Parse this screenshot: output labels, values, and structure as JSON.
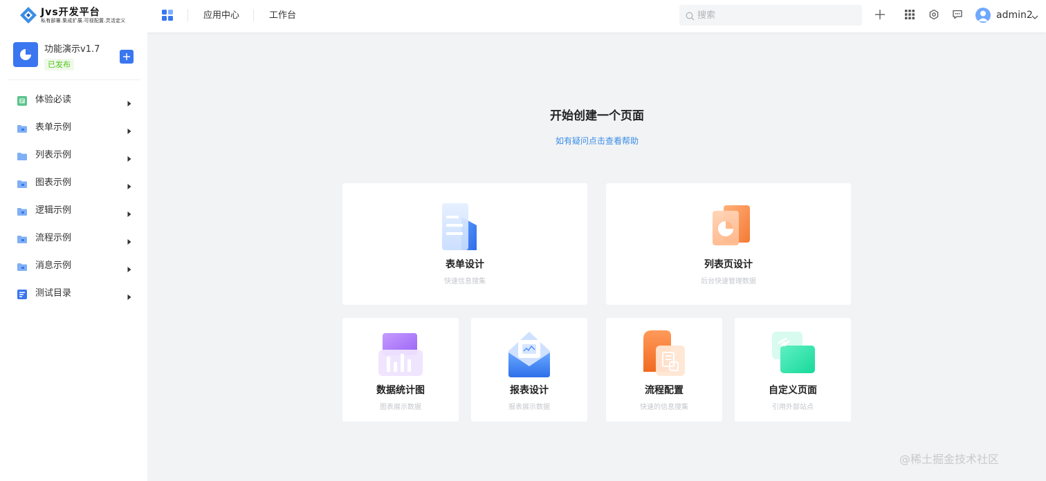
{
  "header": {
    "logo_title": "Jvs开发平台",
    "logo_subtitle": "私有部署.集成扩展.可视配置.灵活定义",
    "nav": [
      "应用中心",
      "工作台"
    ],
    "search_placeholder": "搜索",
    "icons": [
      "plus-icon",
      "grid-icon",
      "gear-icon",
      "message-icon"
    ],
    "username": "admin2"
  },
  "sidebar": {
    "app_name": "功能演示v1.7",
    "app_status": "已发布",
    "items": [
      {
        "label": "体验必读",
        "icon": "doc-green-icon"
      },
      {
        "label": "表单示例",
        "icon": "folder-icon"
      },
      {
        "label": "列表示例",
        "icon": "folder-icon"
      },
      {
        "label": "图表示例",
        "icon": "folder-icon"
      },
      {
        "label": "逻辑示例",
        "icon": "folder-icon"
      },
      {
        "label": "流程示例",
        "icon": "folder-icon"
      },
      {
        "label": "消息示例",
        "icon": "folder-icon"
      },
      {
        "label": "测试目录",
        "icon": "doc-blue-icon"
      }
    ]
  },
  "main": {
    "title": "开始创建一个页面",
    "help_link": "如有疑问点击查看帮助",
    "cards": [
      {
        "title": "表单设计",
        "desc": "快速信息搜集"
      },
      {
        "title": "列表页设计",
        "desc": "后台快速管理数据"
      },
      {
        "title": "数据统计图",
        "desc": "图表展示数据"
      },
      {
        "title": "报表设计",
        "desc": "报表展示数据"
      },
      {
        "title": "流程配置",
        "desc": "快速的信息搜集"
      },
      {
        "title": "自定义页面",
        "desc": "引用外部站点"
      }
    ]
  },
  "watermark": "@稀土掘金技术社区",
  "colors": {
    "accent": "#3a76ef",
    "published": "#52c41a",
    "link": "#3a8ee6"
  }
}
